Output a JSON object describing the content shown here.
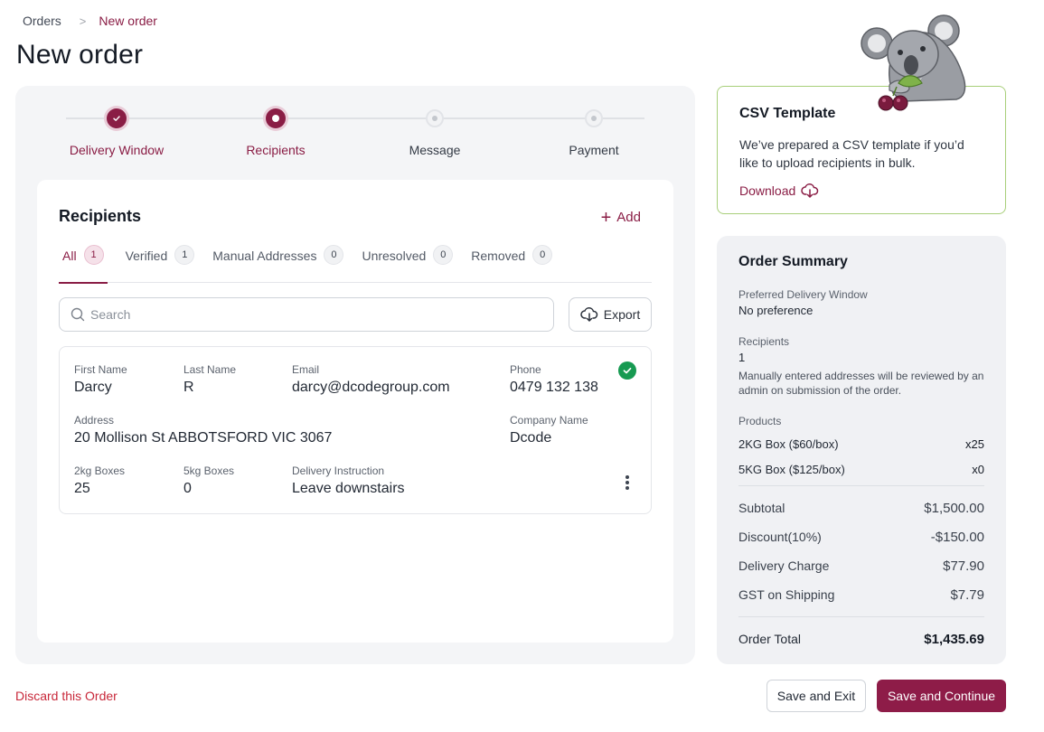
{
  "breadcrumb": {
    "root": "Orders",
    "separator": ">",
    "current": "New order"
  },
  "page": {
    "title": "New order"
  },
  "stepper": {
    "steps": [
      {
        "label": "Delivery Window",
        "state": "done"
      },
      {
        "label": "Recipients",
        "state": "active"
      },
      {
        "label": "Message",
        "state": "todo"
      },
      {
        "label": "Payment",
        "state": "todo"
      }
    ]
  },
  "recipients": {
    "title": "Recipients",
    "add_label": "Add",
    "tabs": [
      {
        "label": "All",
        "count": "1",
        "active": true
      },
      {
        "label": "Verified",
        "count": "1"
      },
      {
        "label": "Manual Addresses",
        "count": "0"
      },
      {
        "label": "Unresolved",
        "count": "0"
      },
      {
        "label": "Removed",
        "count": "0"
      }
    ],
    "search_placeholder": "Search",
    "export_label": "Export",
    "row": {
      "first_name_label": "First Name",
      "first_name": "Darcy",
      "last_name_label": "Last Name",
      "last_name": "R",
      "email_label": "Email",
      "email": "darcy@dcodegroup.com",
      "phone_label": "Phone",
      "phone": "0479 132 138",
      "address_label": "Address",
      "address": "20 Mollison St ABBOTSFORD VIC 3067",
      "company_label": "Company Name",
      "company": "Dcode",
      "boxes_2kg_label": "2kg Boxes",
      "boxes_2kg": "25",
      "boxes_5kg_label": "5kg Boxes",
      "boxes_5kg": "0",
      "instruction_label": "Delivery Instruction",
      "instruction": "Leave downstairs"
    }
  },
  "csv_template": {
    "title": "CSV Template",
    "text": "We’ve prepared a CSV template if you’d like to upload recipients in bulk.",
    "download_label": "Download"
  },
  "summary": {
    "title": "Order Summary",
    "delivery_window_label": "Preferred Delivery Window",
    "delivery_window_value": "No preference",
    "recipients_label": "Recipients",
    "recipients_value": "1",
    "recipients_note": "Manually entered addresses will be reviewed by an admin on submission of the order.",
    "products_label": "Products",
    "products": [
      {
        "name": "2KG Box ($60/box)",
        "qty": "x25"
      },
      {
        "name": "5KG Box ($125/box)",
        "qty": "x0"
      }
    ],
    "totals": [
      {
        "label": "Subtotal",
        "value": "$1,500.00"
      },
      {
        "label": "Discount(10%)",
        "value": "-$150.00"
      },
      {
        "label": "Delivery Charge",
        "value": "$77.90"
      },
      {
        "label": "GST on Shipping",
        "value": "$7.79"
      }
    ],
    "order_total_label": "Order Total",
    "order_total_value": "$1,435.69"
  },
  "footer": {
    "discard_label": "Discard this Order",
    "save_exit_label": "Save and Exit",
    "save_continue_label": "Save and Continue"
  },
  "colors": {
    "brand": "#8a1d45",
    "success": "#179a52",
    "danger": "#c8283a",
    "csv_border": "#a8cf7a"
  },
  "icons": [
    "chevron-right-icon",
    "check-icon",
    "plus-icon",
    "search-icon",
    "cloud-download-icon",
    "kebab-icon",
    "koala-mascot"
  ]
}
